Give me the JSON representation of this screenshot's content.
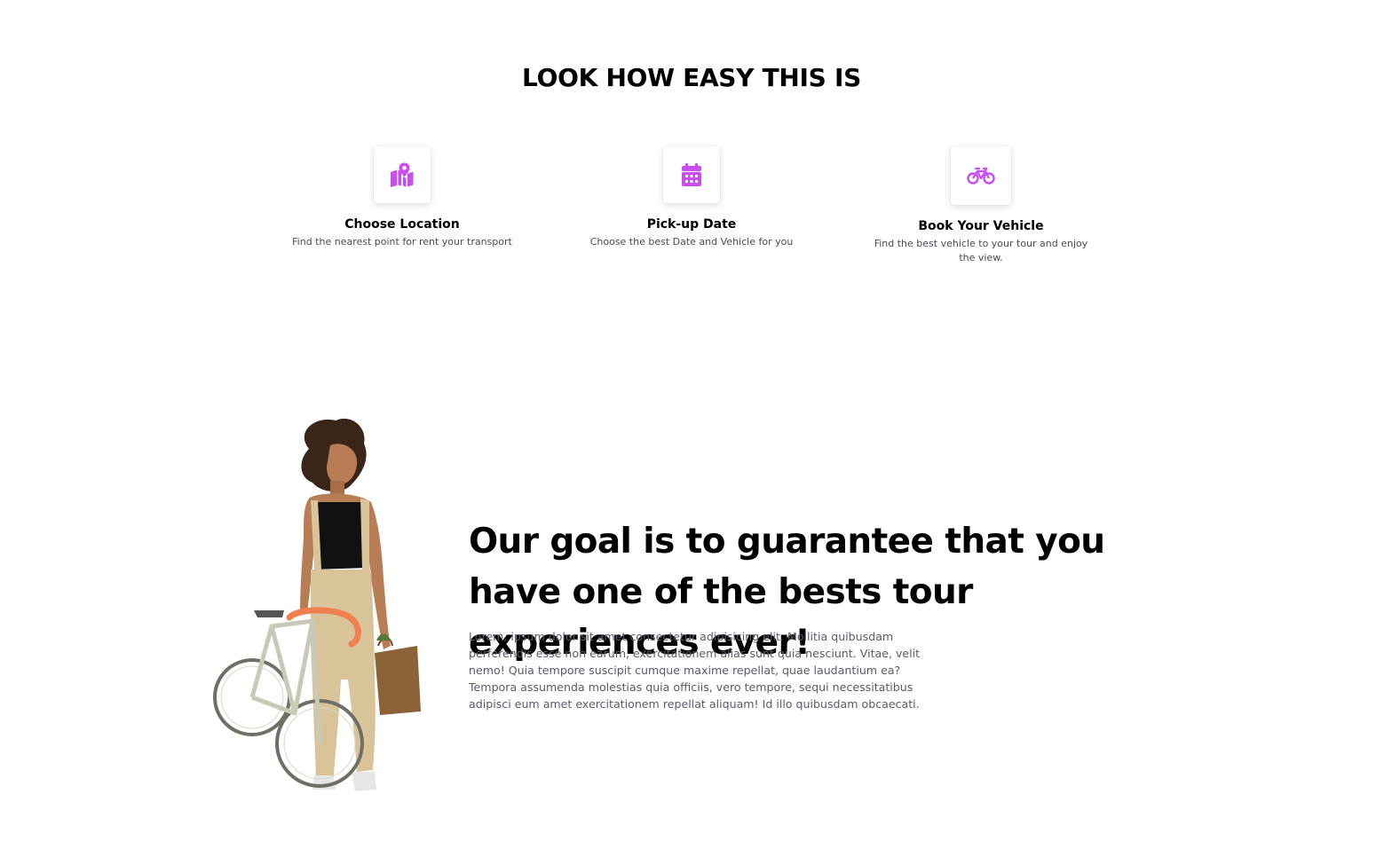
{
  "section": {
    "title": "LOOK HOW EASY THIS IS"
  },
  "steps": [
    {
      "icon": "map-icon",
      "title": "Choose Location",
      "description": "Find the nearest point for rent your transport"
    },
    {
      "icon": "calendar-icon",
      "title": "Pick-up Date",
      "description": "Choose the best Date and Vehicle for you"
    },
    {
      "icon": "bicycle-icon",
      "title": "Book Your Vehicle",
      "description": "Find the best vehicle to your tour and enjoy the view."
    }
  ],
  "goal": {
    "heading": "Our goal is to guarantee that you have one of the bests tour experiences ever!",
    "text": "Lorem, ipsum dolor sit amet consectetur adipisicing elit. Mollitia quibusdam perferendis esse non earum, exercitationem alias sunt quia nesciunt. Vitae, velit nemo! Quia tempore suscipit cumque maxime repellat, quae laudantium ea? Tempora assumenda molestias quia officiis, vero tempore, sequi necessitatibus adipisci eum amet exercitationem repellat aliquam! Id illo quibusdam obcaecati.",
    "image": "woman-with-bicycle-image"
  },
  "colors": {
    "accent": "#c94ef2",
    "heading": "#000000",
    "body_text": "#5a5a6a"
  }
}
